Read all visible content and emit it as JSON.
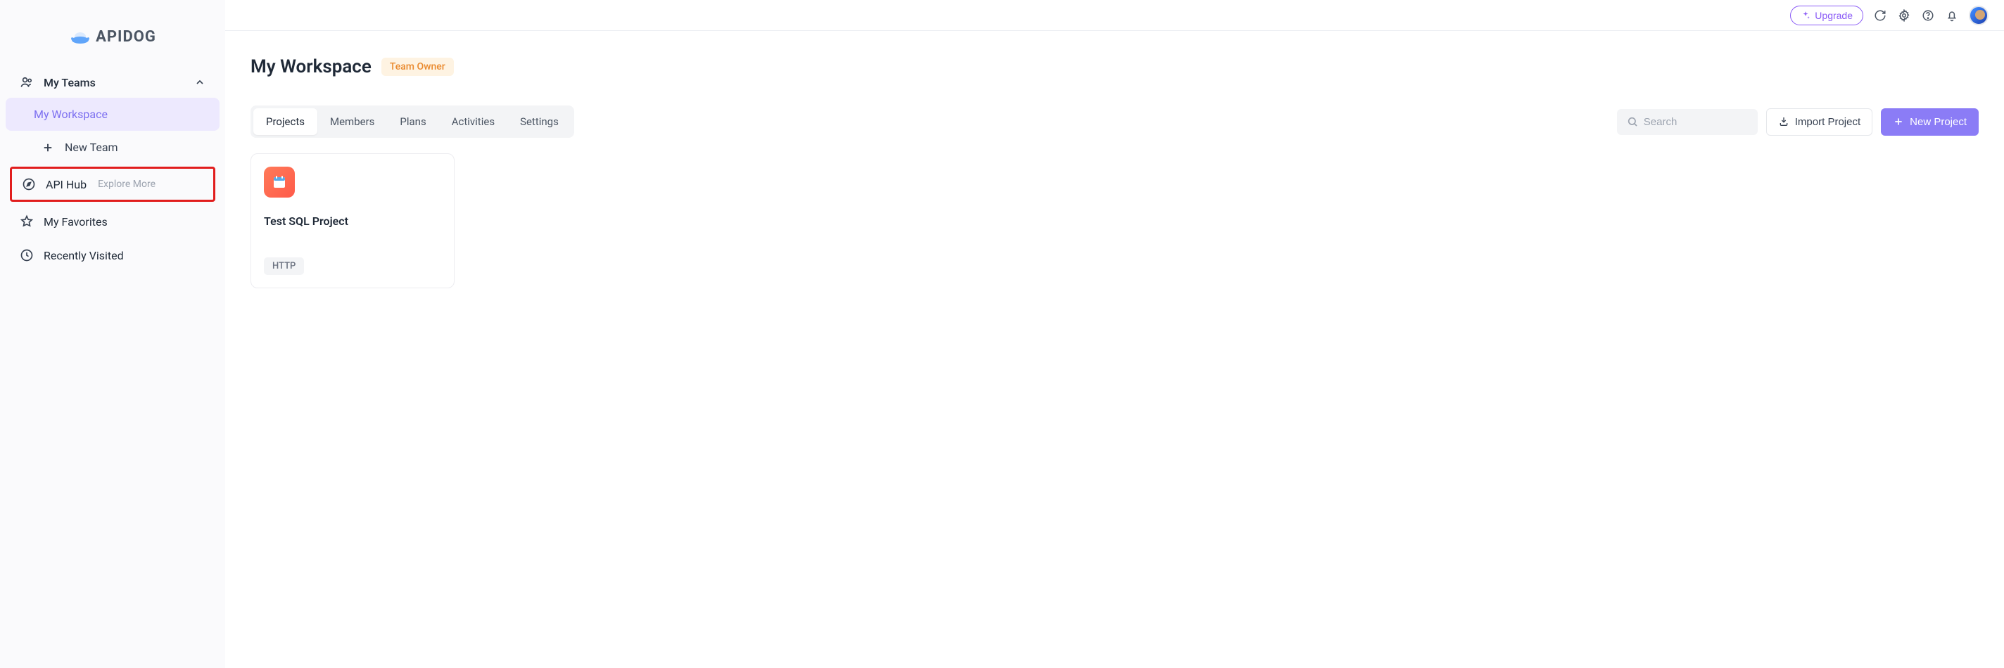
{
  "brand": {
    "name": "APIDOG"
  },
  "topbar": {
    "upgrade_label": "Upgrade"
  },
  "sidebar": {
    "teams_label": "My Teams",
    "workspace_label": "My Workspace",
    "new_team_label": "New Team",
    "api_hub_label": "API Hub",
    "api_hub_meta": "Explore More",
    "favorites_label": "My Favorites",
    "recently_label": "Recently Visited"
  },
  "page": {
    "title": "My Workspace",
    "role_badge": "Team Owner"
  },
  "tabs": [
    {
      "label": "Projects",
      "active": true
    },
    {
      "label": "Members",
      "active": false
    },
    {
      "label": "Plans",
      "active": false
    },
    {
      "label": "Activities",
      "active": false
    },
    {
      "label": "Settings",
      "active": false
    }
  ],
  "search": {
    "placeholder": "Search"
  },
  "buttons": {
    "import_label": "Import Project",
    "new_project_label": "New Project"
  },
  "projects": [
    {
      "name": "Test SQL Project",
      "protocol": "HTTP"
    }
  ]
}
